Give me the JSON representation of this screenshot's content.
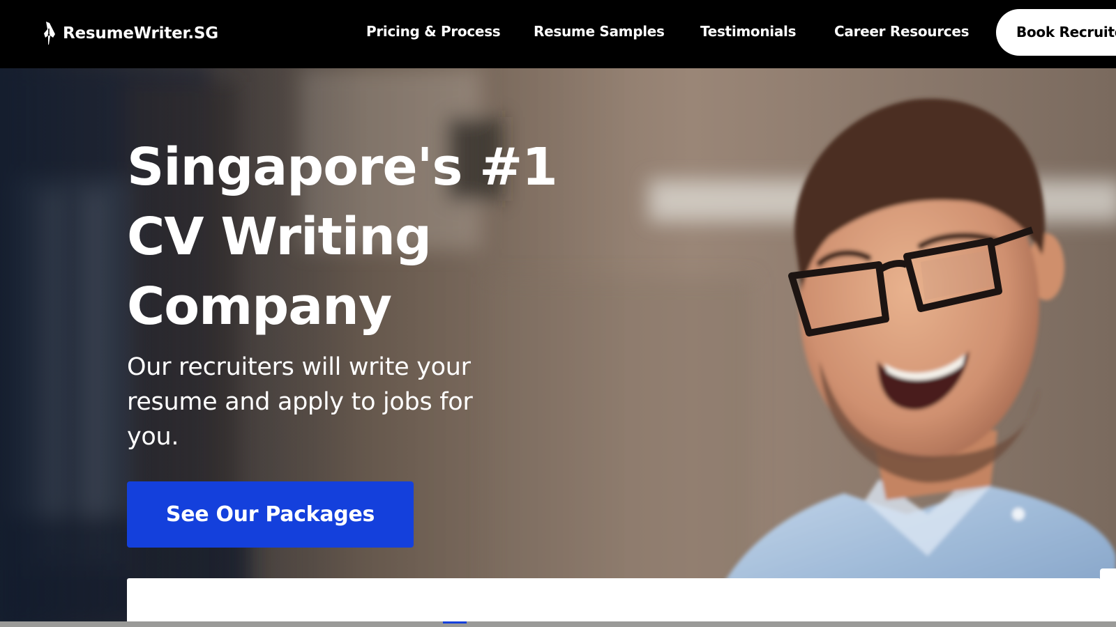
{
  "header": {
    "brand": "ResumeWriter.SG",
    "logo_icon": "fountain-pen-icon",
    "nav": [
      {
        "label": "Pricing & Process"
      },
      {
        "label": "Resume Samples"
      },
      {
        "label": "Testimonials"
      },
      {
        "label": "Career Resources"
      }
    ],
    "book_button_label": "Book Recruiter"
  },
  "hero": {
    "title": "Singapore's #1 CV Writing Company",
    "subtitle": "Our recruiters will write your resume and apply to jobs for you.",
    "cta_label": "See Our Packages",
    "photo": "smiling-man-with-glasses-photo"
  },
  "colors": {
    "nav_background": "#000000",
    "cta_background": "#1440dc",
    "text_light": "#ffffff",
    "card_background": "#ffffff"
  }
}
